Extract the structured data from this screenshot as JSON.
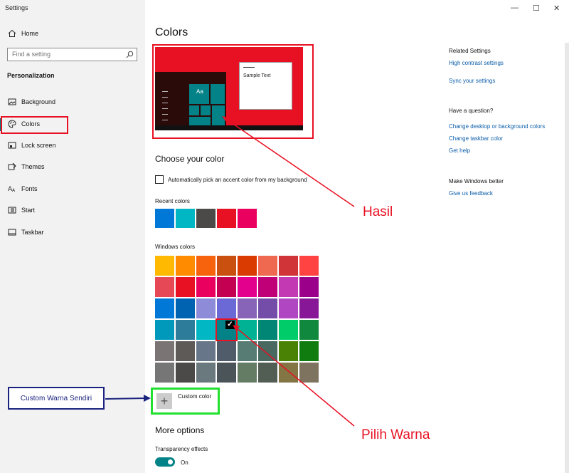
{
  "window": {
    "title": "Settings",
    "minimize": "—",
    "maximize": "☐",
    "close": "✕"
  },
  "sidebar": {
    "home": "Home",
    "search_placeholder": "Find a setting",
    "section": "Personalization",
    "items": [
      {
        "label": "Background",
        "icon": "image-icon"
      },
      {
        "label": "Colors",
        "icon": "palette-icon"
      },
      {
        "label": "Lock screen",
        "icon": "lock-screen-icon"
      },
      {
        "label": "Themes",
        "icon": "themes-icon"
      },
      {
        "label": "Fonts",
        "icon": "fonts-icon"
      },
      {
        "label": "Start",
        "icon": "start-icon"
      },
      {
        "label": "Taskbar",
        "icon": "taskbar-icon"
      }
    ],
    "selected": "Colors"
  },
  "main": {
    "title": "Colors",
    "preview": {
      "sample_text": "Sample Text",
      "tile_text": "Aa",
      "accent": "#e81123"
    },
    "choose_heading": "Choose your color",
    "auto_pick_label": "Automatically pick an accent color from my background",
    "recent_label": "Recent colors",
    "recent_colors": [
      "#0078d7",
      "#00b7c3",
      "#4c4a48",
      "#e81123",
      "#ea005e"
    ],
    "windows_label": "Windows colors",
    "windows_colors": [
      [
        "#ffb900",
        "#ff8c00",
        "#f7630c",
        "#ca5010",
        "#da3b01",
        "#ef6950",
        "#d13438",
        "#ff4343"
      ],
      [
        "#e74856",
        "#e81123",
        "#ea005e",
        "#c30052",
        "#e3008c",
        "#bf0077",
        "#c239b3",
        "#9a0089"
      ],
      [
        "#0078d7",
        "#0063b1",
        "#8e8cd8",
        "#6b69d6",
        "#8764b8",
        "#744da9",
        "#b146c2",
        "#881798"
      ],
      [
        "#0099bc",
        "#2d7d9a",
        "#00b7c3",
        "#038387",
        "#00b294",
        "#018574",
        "#00cc6a",
        "#10893e"
      ],
      [
        "#7a7574",
        "#5d5a58",
        "#68768a",
        "#515c6b",
        "#567c73",
        "#486860",
        "#498205",
        "#107c10"
      ],
      [
        "#767676",
        "#4c4a48",
        "#69797e",
        "#4a5459",
        "#647c64",
        "#525e54",
        "#847545",
        "#7e735f"
      ]
    ],
    "selected_color": "#038387",
    "custom_color_label": "Custom color",
    "more_options_heading": "More options",
    "transparency_label": "Transparency effects",
    "transparency_state": "On"
  },
  "related": {
    "heading": "Related Settings",
    "links": [
      "High contrast settings",
      "Sync your settings"
    ],
    "question_heading": "Have a question?",
    "question_links": [
      "Change desktop or background colors",
      "Change taskbar color",
      "Get help"
    ],
    "better_heading": "Make Windows better",
    "better_links": [
      "Give us feedback"
    ]
  },
  "annotations": {
    "result_label": "Hasil",
    "pick_label": "Pilih Warna",
    "custom_label": "Custom Warna Sendiri",
    "red": "#e81123",
    "green": "#22e030",
    "blue": "#1a237e"
  }
}
